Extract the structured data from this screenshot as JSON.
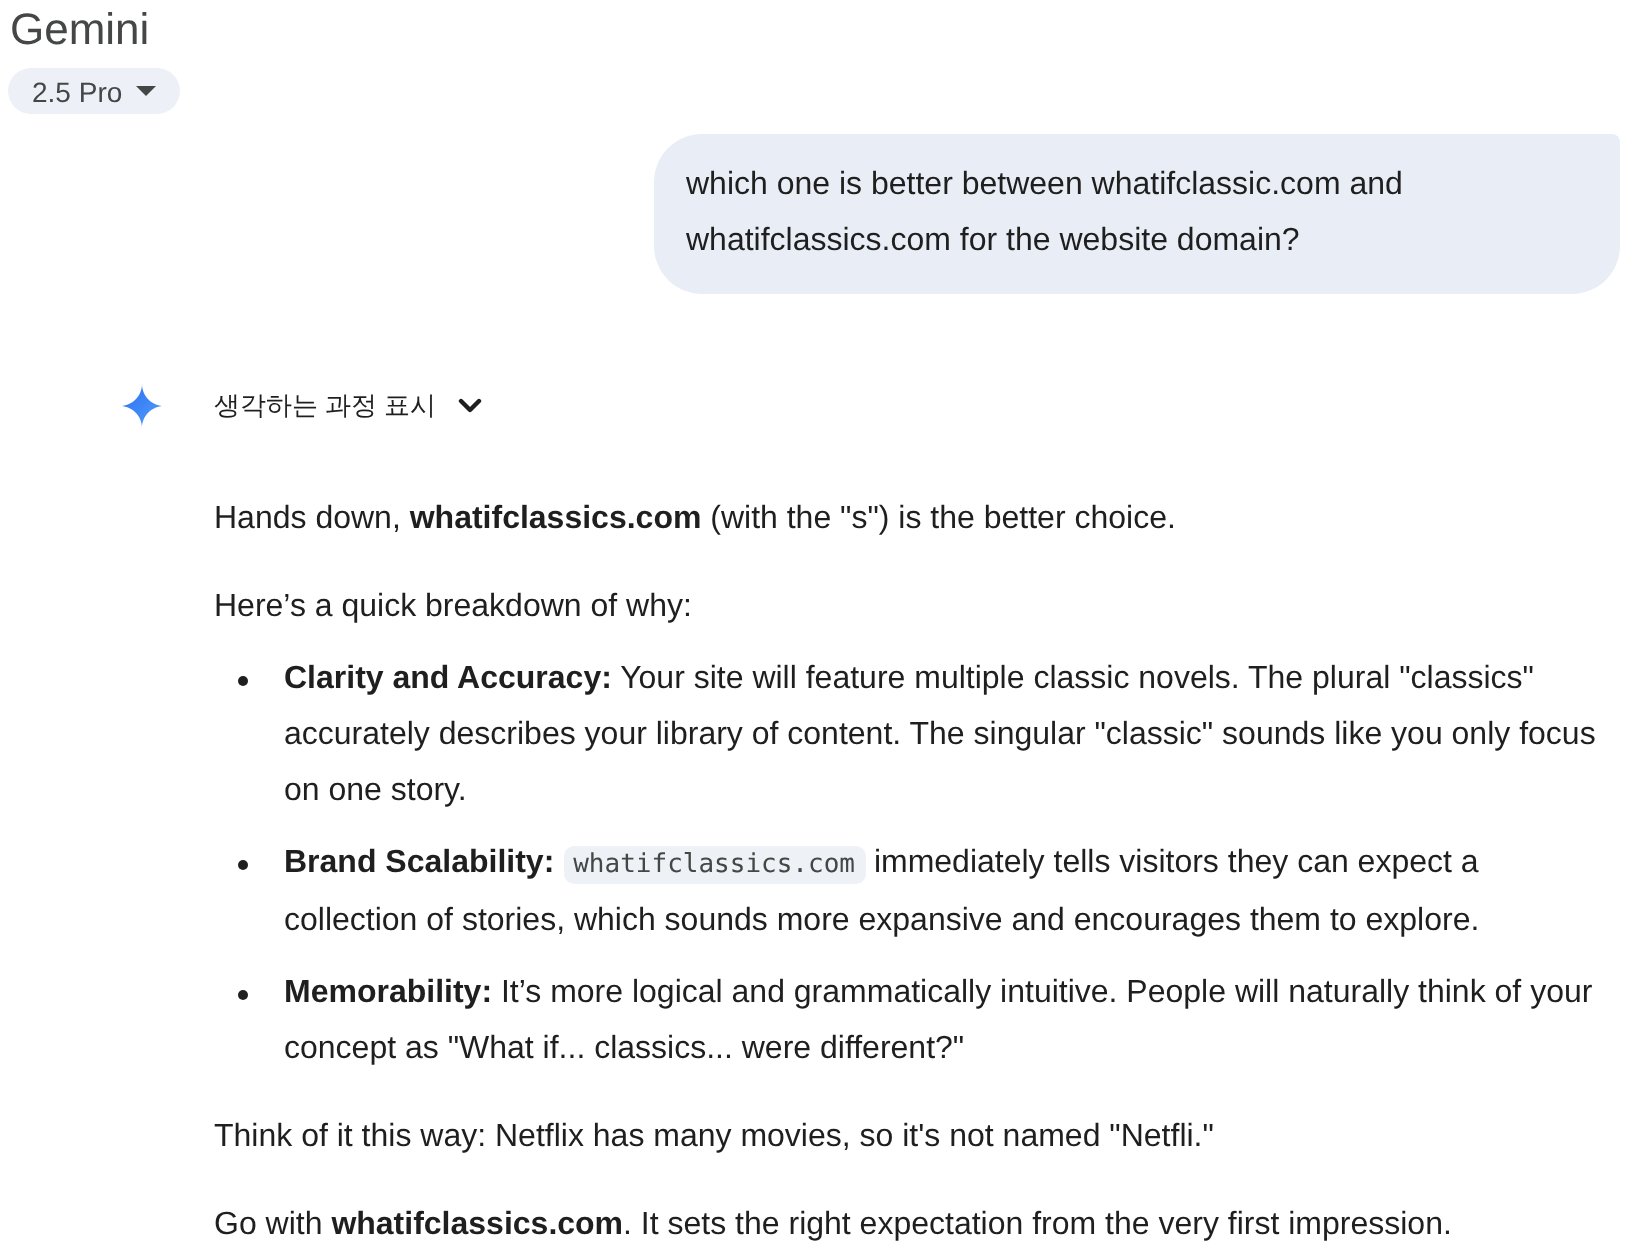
{
  "header": {
    "title": "Gemini",
    "model_picker": {
      "label": "2.5 Pro"
    }
  },
  "user_message": {
    "text": "which one is better between whatifclassic.com and whatifclassics.com for the website domain?"
  },
  "response": {
    "thinking_toggle": {
      "label": "생각하는 과정 표시",
      "expanded": false
    },
    "blocks": [
      {
        "kind": "paragraph",
        "text": "Hands down, **whatifclassics.com** (with the \"s\") is the better choice."
      },
      {
        "kind": "paragraph",
        "text": "Here’s a quick breakdown of why:"
      },
      {
        "kind": "list",
        "items": [
          {
            "segments": [
              {
                "kind": "text",
                "text": "**Clarity and Accuracy:** Your site will feature multiple classic novels. The plural \"classics\" accurately describes your library of content. The singular \"classic\" sounds like you only focus on one story."
              }
            ]
          },
          {
            "segments": [
              {
                "kind": "text",
                "text": "**Brand Scalability:** "
              },
              {
                "kind": "code",
                "text": "whatifclassics.com"
              },
              {
                "kind": "text",
                "text": " immediately tells visitors they can expect a collection of stories, which sounds more expansive and encourages them to explore."
              }
            ]
          },
          {
            "segments": [
              {
                "kind": "text",
                "text": "**Memorability:** It’s more logical and grammatically intuitive. People will naturally think of your concept as \"What if... classics... were different?\""
              }
            ]
          }
        ]
      },
      {
        "kind": "paragraph",
        "text": "Think of it this way: Netflix has many movies, so it's not named \"Netfli.\""
      },
      {
        "kind": "paragraph",
        "text": "Go with **whatifclassics.com**. It sets the right expectation from the very first impression."
      }
    ]
  }
}
